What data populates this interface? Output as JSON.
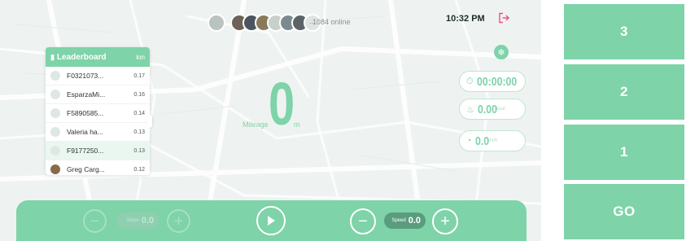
{
  "header": {
    "online_text": "1084 online",
    "time": "10:32 PM",
    "exit_icon": "exit-icon",
    "avatars": [
      "#b9c3c0",
      "#6e6358",
      "#4a5560",
      "#8a7a5a",
      "#c8d0cc",
      "#7c8a90",
      "#5d6468",
      "#e0e4e2"
    ]
  },
  "leaderboard": {
    "title": "Leaderboard",
    "unit": "km",
    "rows": [
      {
        "name": "F0321073...",
        "km": "0.17"
      },
      {
        "name": "EsparzaMi...",
        "km": "0.16"
      },
      {
        "name": "F5890585...",
        "km": "0.14"
      },
      {
        "name": "Valeria ha...",
        "km": "0.13"
      },
      {
        "name": "F9177250...",
        "km": "0.13"
      },
      {
        "name": "Greg Carg...",
        "km": "0.12"
      }
    ]
  },
  "mileage": {
    "label": "Mileage",
    "value": "0",
    "unit": "m"
  },
  "stats": {
    "timer": "00:00:00",
    "calories": "0.00",
    "calories_unit": "kcal",
    "speed": "0.0",
    "speed_unit": "km/h"
  },
  "controls": {
    "slope_label": "Slope",
    "slope_value": "0.0",
    "speed_label": "Speed",
    "speed_value": "0.0"
  },
  "side_buttons": [
    "3",
    "2",
    "1",
    "GO"
  ],
  "colors": {
    "accent": "#7ed3a9",
    "exit": "#e8507a"
  }
}
